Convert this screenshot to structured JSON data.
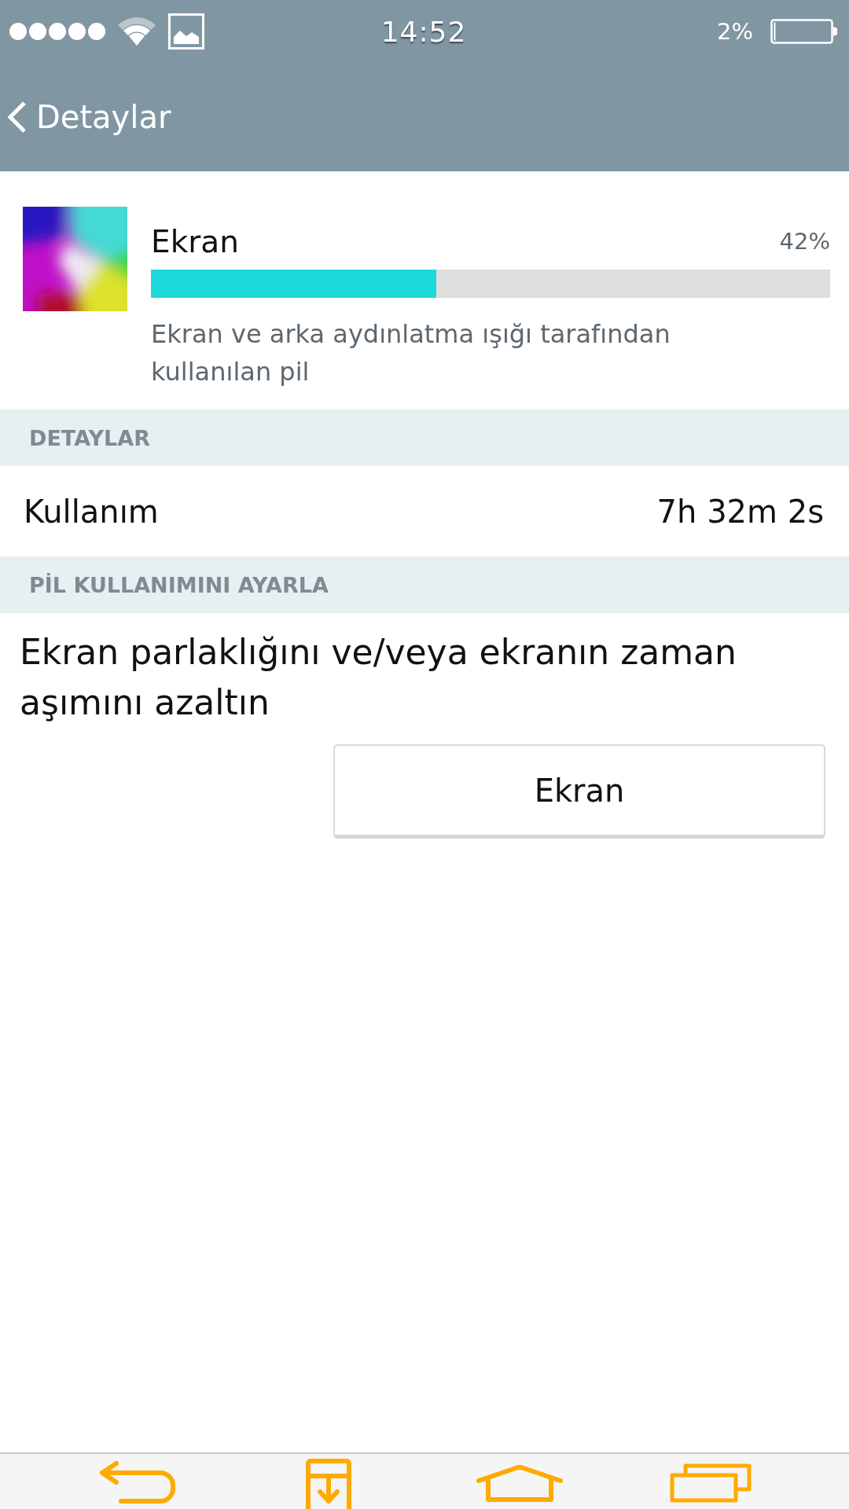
{
  "status_bar": {
    "time": "14:52",
    "battery": "2%"
  },
  "header": {
    "title": "Detaylar"
  },
  "app": {
    "name": "Ekran",
    "percent": "42%",
    "level": 0.42,
    "description": "Ekran ve arka aydınlatma ışığı tarafından kullanılan pil"
  },
  "sections": [
    {
      "title": "DETAYLAR",
      "kind": "rows",
      "rows": [
        {
          "label": "Kullanım",
          "value": "7h 32m 2s"
        }
      ]
    },
    {
      "title": "PİL KULLANIMINI AYARLA",
      "kind": "advice",
      "text": "Ekran parlaklığını ve/veya ekranın zaman aşımını azaltın",
      "button": "Ekran"
    }
  ]
}
